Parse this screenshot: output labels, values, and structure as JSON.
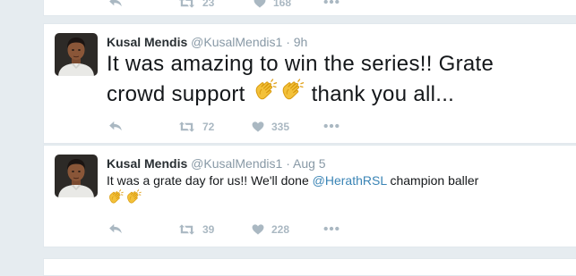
{
  "previous_tweet": {
    "retweet_count": "23",
    "like_count": "168"
  },
  "tweets": [
    {
      "display_name": "Kusal Mendis",
      "handle": "@KusalMendis1",
      "separator": "·",
      "time": "9h",
      "text_line1": "It was amazing to win the series!! Grate",
      "text_line2_before": "crowd support",
      "text_line2_after": "thank you all...",
      "retweet_count": "72",
      "like_count": "335"
    },
    {
      "display_name": "Kusal Mendis",
      "handle": "@KusalMendis1",
      "separator": "·",
      "time": "Aug 5",
      "text_before": "It was a grate day for us!! We'll done",
      "mention": "@HerathRSL",
      "text_after": "champion baller",
      "retweet_count": "39",
      "like_count": "228"
    }
  ],
  "icons": {
    "reply": "reply-icon",
    "retweet": "retweet-icon",
    "like": "heart-icon",
    "more": "more-icon",
    "clap": "clapping-hands-emoji"
  },
  "colors": {
    "background": "#e6ecf0",
    "action_gray": "#aab8c2",
    "mention_blue": "#3a84b5",
    "text_dark": "#14171a"
  }
}
